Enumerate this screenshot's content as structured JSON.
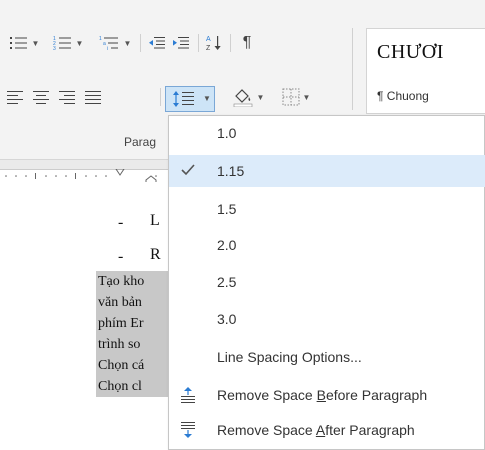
{
  "ribbon": {
    "group_label": "Parag",
    "styles": {
      "heading_preview": "CHƯƠI",
      "normal_preview": "¶ Chuong"
    }
  },
  "document": {
    "bullets": [
      {
        "dash": "-",
        "text": "L"
      },
      {
        "dash": "-",
        "text": "R"
      }
    ],
    "selected_lines": [
      "Tạo kho",
      "văn bản",
      "phím Er",
      "trình so",
      "Chọn cá",
      "Chọn cl"
    ]
  },
  "line_spacing_menu": {
    "options": [
      {
        "label": "1.0",
        "checked": false
      },
      {
        "label": "1.15",
        "checked": true
      },
      {
        "label": "1.5",
        "checked": false
      },
      {
        "label": "2.0",
        "checked": false
      },
      {
        "label": "2.5",
        "checked": false
      },
      {
        "label": "3.0",
        "checked": false
      }
    ],
    "more": "Line Spacing Options...",
    "remove_before": {
      "pre": "Remove Space ",
      "key": "B",
      "post": "efore Paragraph"
    },
    "remove_after": {
      "pre": "Remove Space ",
      "key": "A",
      "post": "fter Paragraph"
    }
  },
  "colors": {
    "accent": "#2b7cd3",
    "selection": "#c8c8c8",
    "menu_hover": "#dcebfa"
  }
}
